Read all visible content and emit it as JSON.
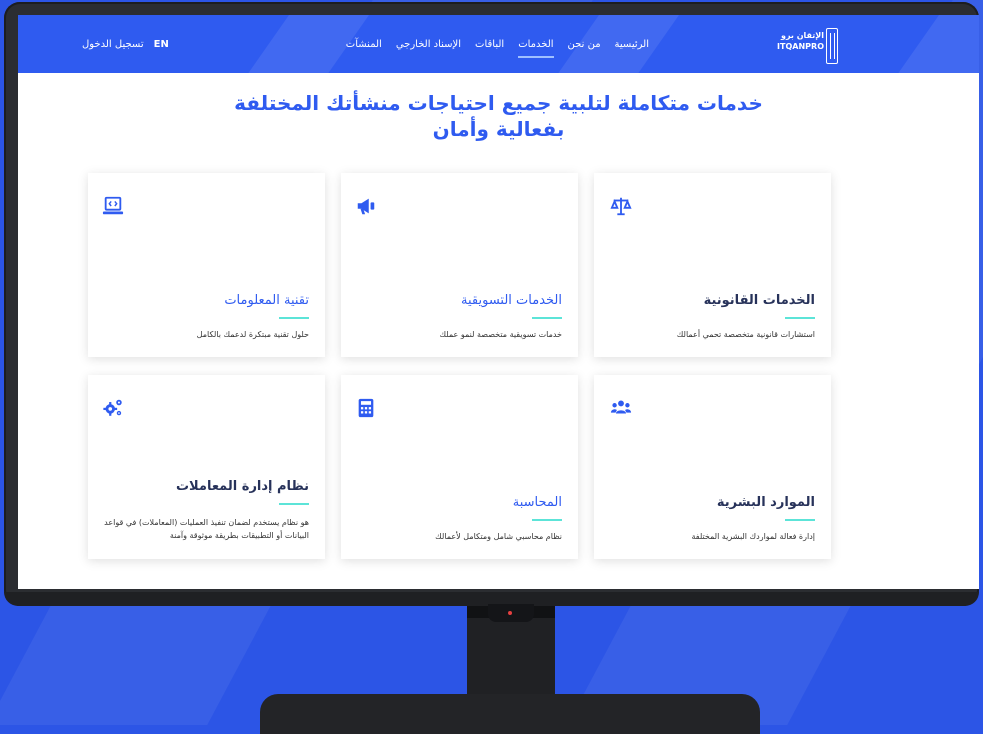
{
  "navbar": {
    "logo_arabic": "الإتقان برو",
    "logo_latin": "ITQANPRO",
    "links": [
      "الرئيسية",
      "من نحن",
      "الخدمات",
      "الباقات",
      "الإسناد الخارجي",
      "المنشآت"
    ],
    "active_link": "الخدمات",
    "lang_label": "EN",
    "login_label": "تسجيل الدخول"
  },
  "hero": {
    "line1": "خدمات متكاملة لتلبية جميع احتياجات منشأتك المختلفة",
    "line2": "بفعالية وأمان"
  },
  "cards": [
    {
      "title": "الخدمات القانونية",
      "desc": "استشارات قانونية متخصصة تحمي أعمالك",
      "icon": "scale-icon"
    },
    {
      "title": "الخدمات التسويقية",
      "desc": "خدمات تسويقية متخصصة لنمو عملك",
      "icon": "megaphone-icon"
    },
    {
      "title": "تقنية المعلومات",
      "desc": "حلول تقنية مبتكرة لدعمك بالكامل",
      "icon": "laptop-code-icon"
    },
    {
      "title": "الموارد البشرية",
      "desc": "إدارة فعالة لمواردك البشرية المختلفة",
      "icon": "users-icon"
    },
    {
      "title": "المحاسبة",
      "desc": "نظام محاسبي شامل ومتكامل لأعمالك",
      "icon": "calculator-icon"
    },
    {
      "title": "نظام إدارة المعاملات",
      "desc": "هو نظام يستخدم لضمان تنفيذ العمليات (المعاملات) في قواعد البيانات أو التطبيقات بطريقة موثوقة وآمنة",
      "icon": "gears-icon"
    }
  ],
  "colors": {
    "brand": "#2f5bf0",
    "accent_line": "#5ce4d8",
    "background": "#2c55e6"
  }
}
